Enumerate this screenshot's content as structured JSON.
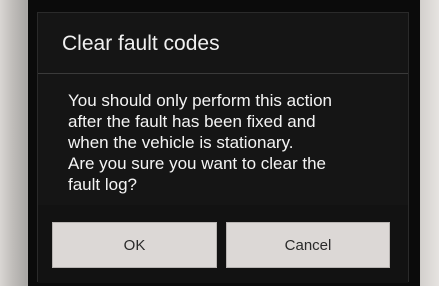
{
  "dialog": {
    "title": "Clear fault codes",
    "message_lines": [
      "You should only perform this action",
      "after the fault has been fixed and",
      "when the vehicle is stationary.",
      "Are you sure you want to clear the",
      "fault log?"
    ],
    "ok_label": "OK",
    "cancel_label": "Cancel"
  }
}
